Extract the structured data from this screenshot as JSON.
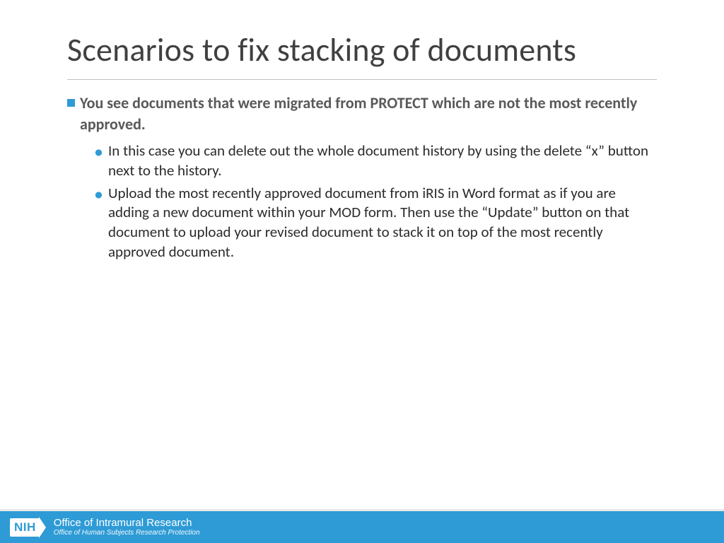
{
  "slide": {
    "title": "Scenarios to fix stacking of documents",
    "heading": "You see documents that were migrated from PROTECT which are not the most recently approved.",
    "bullets": [
      "In this case you can delete out the whole document history by using the delete “x” button next to the history.",
      "Upload the most recently approved document from iRIS in Word format as if you are adding a new document within your MOD form. Then use the “Update” button on that document to upload your revised document to stack it on top of the most recently approved document."
    ]
  },
  "footer": {
    "logo_text": "NIH",
    "line1": "Office of Intramural Research",
    "line2": "Office of Human Subjects Research Protection"
  }
}
